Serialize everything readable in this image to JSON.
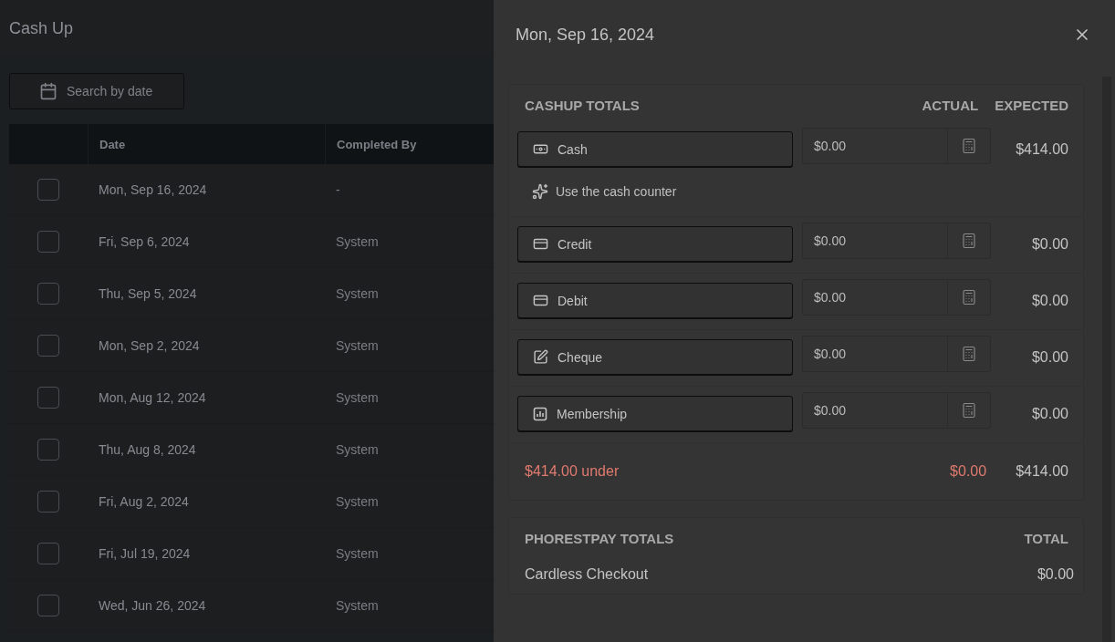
{
  "page": {
    "title": "Cash Up"
  },
  "search": {
    "placeholder": "Search by date"
  },
  "table": {
    "columns": [
      "Date",
      "Completed By"
    ],
    "rows": [
      {
        "date": "Mon, Sep 16, 2024",
        "completed_by": "-",
        "checked": false
      },
      {
        "date": "Fri, Sep 6, 2024",
        "completed_by": "System",
        "checked": false
      },
      {
        "date": "Thu, Sep 5, 2024",
        "completed_by": "System",
        "checked": false
      },
      {
        "date": "Mon, Sep 2, 2024",
        "completed_by": "System",
        "checked": false
      },
      {
        "date": "Mon, Aug 12, 2024",
        "completed_by": "System",
        "checked": false
      },
      {
        "date": "Thu, Aug 8, 2024",
        "completed_by": "System",
        "checked": false
      },
      {
        "date": "Fri, Aug 2, 2024",
        "completed_by": "System",
        "checked": false
      },
      {
        "date": "Fri, Jul 19, 2024",
        "completed_by": "System",
        "checked": false
      },
      {
        "date": "Wed, Jun 26, 2024",
        "completed_by": "System",
        "checked": false
      }
    ]
  },
  "drawer": {
    "title": "Mon, Sep 16, 2024",
    "cashup": {
      "title": "CASHUP TOTALS",
      "columns": [
        "ACTUAL",
        "EXPECTED"
      ],
      "methods": [
        {
          "kind": "cash",
          "label": "Cash",
          "actual": "$0.00",
          "expected": "$414.00",
          "link": "Use the cash counter"
        },
        {
          "kind": "card",
          "label": "Credit",
          "actual": "$0.00",
          "expected": "$0.00"
        },
        {
          "kind": "card",
          "label": "Debit",
          "actual": "$0.00",
          "expected": "$0.00"
        },
        {
          "kind": "cheque",
          "label": "Cheque",
          "actual": "$0.00",
          "expected": "$0.00"
        },
        {
          "kind": "membership",
          "label": "Membership",
          "actual": "$0.00",
          "expected": "$0.00"
        }
      ],
      "summary": {
        "difference": "$414.00 under",
        "actual": "$0.00",
        "expected": "$414.00",
        "balanced": false
      }
    },
    "phorestpay": {
      "title": "PHORESTPAY TOTALS",
      "column": "TOTAL",
      "rows": [
        {
          "label": "Cardless Checkout",
          "total": "$0.00"
        }
      ]
    }
  }
}
